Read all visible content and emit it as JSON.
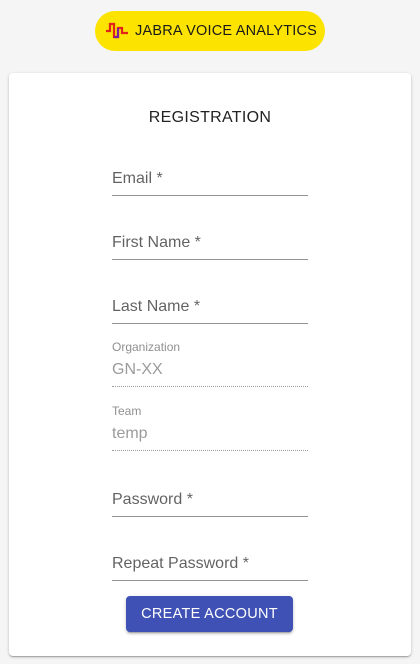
{
  "brand": {
    "name": "JABRA VOICE ANALYTICS",
    "pill_color": "#fce300",
    "mark_colors": [
      "#e2231a",
      "#7a1fa2"
    ],
    "icon": "jabra-waveform-icon"
  },
  "form": {
    "title": "REGISTRATION",
    "fields": [
      {
        "label": "Email *",
        "value": ""
      },
      {
        "label": "First Name *",
        "value": ""
      },
      {
        "label": "Last Name *",
        "value": ""
      },
      {
        "label": "Organization",
        "value": "GN-XX",
        "disabled": true
      },
      {
        "label": "Team",
        "value": "temp",
        "disabled": true
      },
      {
        "label": "Password *",
        "value": ""
      },
      {
        "label": "Repeat Password *",
        "value": ""
      }
    ],
    "submit_label": "CREATE ACCOUNT",
    "submit_color": "#3f51b5"
  }
}
